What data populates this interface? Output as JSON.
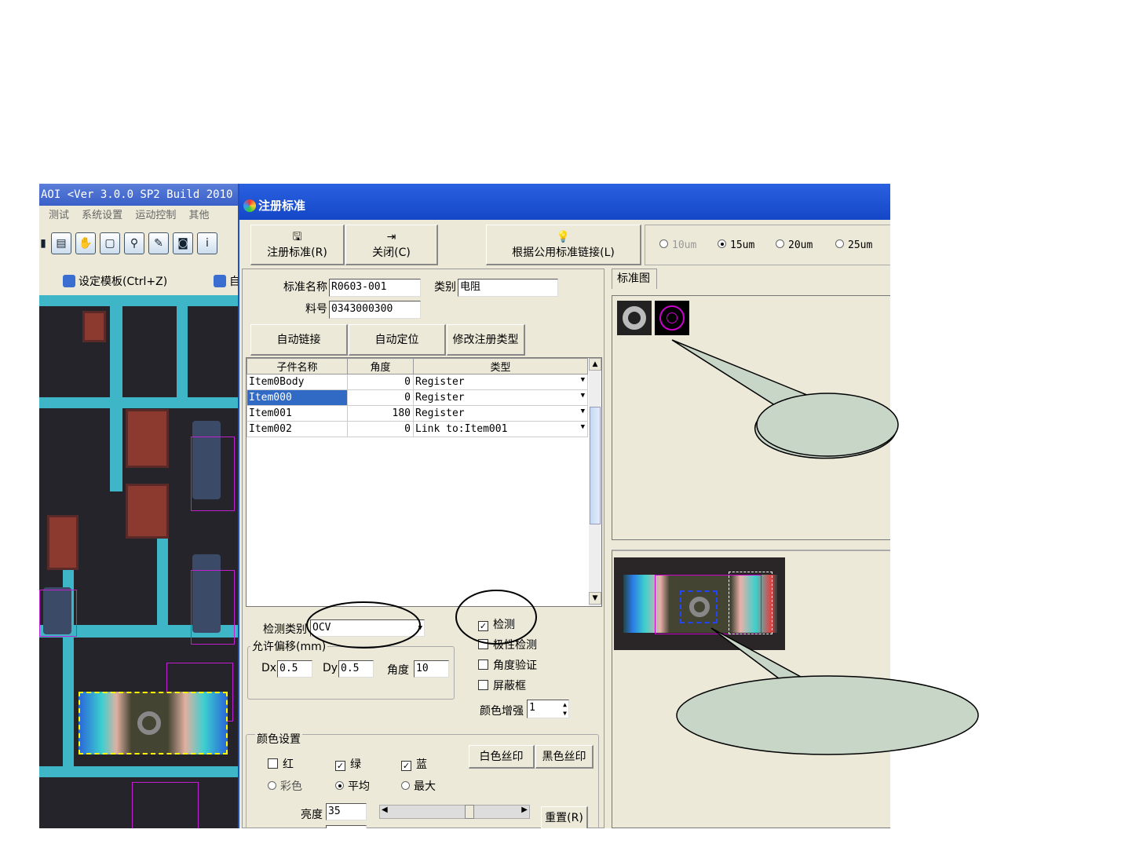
{
  "background_app": {
    "title": "AOI  <Ver 3.0.0 SP2 Build 2010",
    "menu": [
      "测试",
      "系统设置",
      "运动控制",
      "其他"
    ],
    "template_label": "设定模板(Ctrl+Z)",
    "template_label2": "自"
  },
  "dialog": {
    "title": "注册标准",
    "toolbar": {
      "register_label": "注册标准(R)",
      "close_label": "关闭(C)",
      "link_label": "根据公用标准链接(L)",
      "resolution_options": [
        "10um",
        "15um",
        "20um",
        "25um"
      ],
      "resolution_selected": "15um"
    },
    "form": {
      "std_name_label": "标准名称",
      "std_name_value": "R0603-001",
      "category_label": "类别",
      "category_value": "电阻",
      "part_no_label": "料号",
      "part_no_value": "0343000300",
      "auto_link": "自动链接",
      "auto_locate": "自动定位",
      "modify_type": "修改注册类型"
    },
    "grid": {
      "headers": [
        "子件名称",
        "角度",
        "类型"
      ],
      "rows": [
        {
          "name": "Item0Body",
          "angle": "0",
          "type": "Register"
        },
        {
          "name": "Item000",
          "angle": "0",
          "type": "Register"
        },
        {
          "name": "Item001",
          "angle": "180",
          "type": "Register"
        },
        {
          "name": "Item002",
          "angle": "0",
          "type": "Link to:Item001"
        }
      ],
      "selected_row": 1
    },
    "detect": {
      "type_label": "检测类别",
      "type_value": "OCV",
      "offset_group": "允许偏移(mm)",
      "dx_label": "Dx",
      "dx_value": "0.5",
      "dy_label": "Dy",
      "dy_value": "0.5",
      "angle_label": "角度",
      "angle_value": "10",
      "check_detect": "检测",
      "check_polarity": "极性检测",
      "check_angle": "角度验证",
      "check_mask": "屏蔽框",
      "color_boost_label": "颜色增强",
      "color_boost_value": "1"
    },
    "color": {
      "group": "颜色设置",
      "red": "红",
      "green": "绿",
      "blue": "蓝",
      "colorful": "彩色",
      "average": "平均",
      "max": "最大",
      "white_print": "白色丝印",
      "black_print": "黑色丝印",
      "brightness_label": "亮度",
      "brightness_value": "35",
      "reset": "重置(R)"
    },
    "right_panel": {
      "tab": "标准图"
    }
  }
}
